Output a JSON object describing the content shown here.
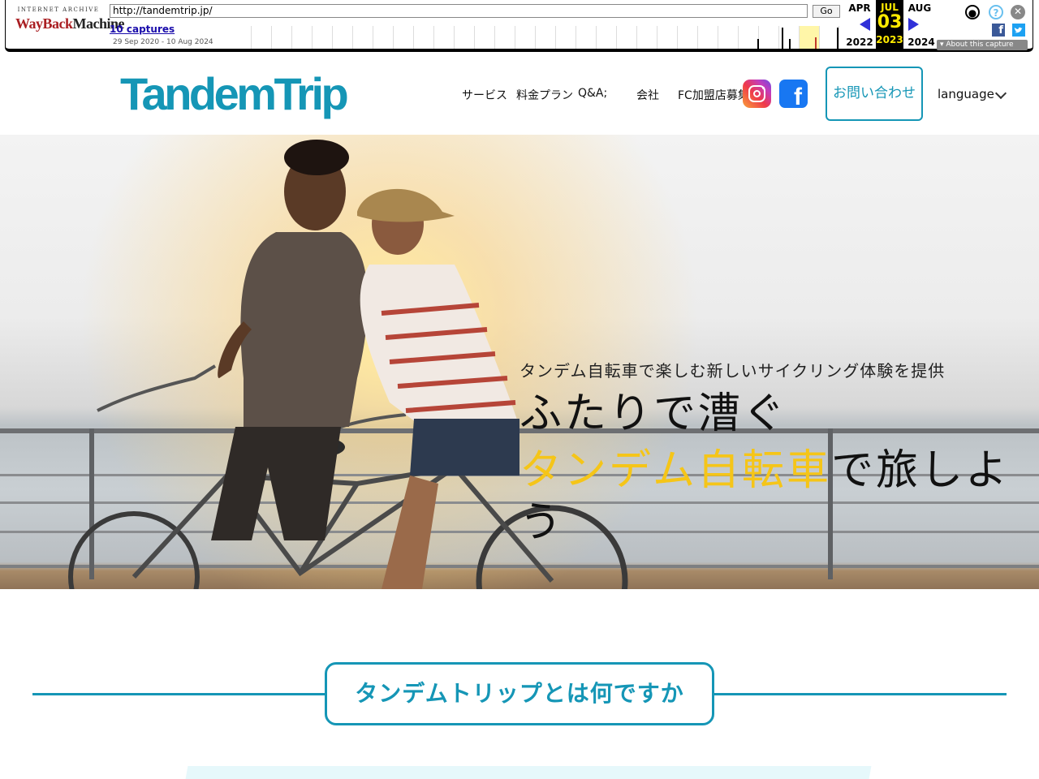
{
  "wayback": {
    "logo_top": "INTERNET ARCHIVE",
    "logo_way": "WayBack",
    "logo_machine": "Machine",
    "url": "http://tandemtrip.jp/",
    "go": "Go",
    "captures": "10 captures",
    "range": "29 Sep 2020 - 10 Aug 2024",
    "prev_month": "APR",
    "prev_year": "2022",
    "cur_month": "JUL",
    "cur_day": "03",
    "cur_year": "2023",
    "next_month": "AUG",
    "next_year": "2024",
    "about": "About this capture",
    "icons": [
      "user-icon",
      "help-icon",
      "close-icon",
      "facebook-share-icon",
      "twitter-share-icon"
    ]
  },
  "site": {
    "logo": "TandemTrip",
    "nav": [
      "サービス",
      "料金プラン",
      "Q&A;",
      "会社",
      "FC加盟店募集"
    ],
    "cta": "お問い合わせ",
    "language": "language",
    "accent": "#1596b6"
  },
  "hero": {
    "subtitle": "タンデム自転車で楽しむ新しいサイクリング体験を提供",
    "title_line1": "ふたりで漕ぐ",
    "title_highlight": "タンデム自転車",
    "title_rest": "で旅しよう",
    "highlight_color": "#f5c518"
  },
  "section": {
    "title": "タンデムトリップとは何ですか"
  }
}
